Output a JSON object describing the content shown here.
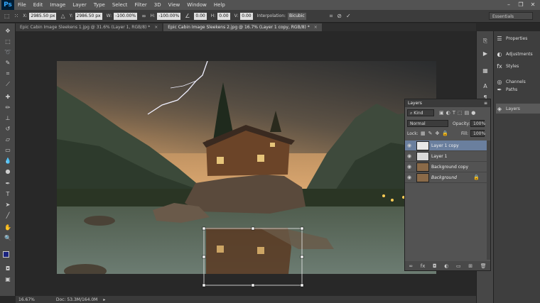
{
  "app": {
    "logo": "Ps"
  },
  "menu": [
    "File",
    "Edit",
    "Image",
    "Layer",
    "Type",
    "Select",
    "Filter",
    "3D",
    "View",
    "Window",
    "Help"
  ],
  "window_controls": [
    "–",
    "❐",
    "✕"
  ],
  "options": {
    "x_label": "X:",
    "x_value": "2985.50 px",
    "y_label": "Y:",
    "y_value": "2986.50 px",
    "w_label": "W:",
    "w_value": "-100.00%",
    "h_label": "H:",
    "h_value": "-100.00%",
    "angle_value": "0.00",
    "hskew_label": "H:",
    "hskew_value": "0.00",
    "vskew_label": "V:",
    "vskew_value": "0.00",
    "interpolation_label": "Interpolation:",
    "interpolation_value": "Bicubic",
    "workspace": "Essentials"
  },
  "tabs": [
    {
      "label": "Epic Cabin Image Sleekens 1.jpg @ 31.6% (Layer 1, RGB/8) *",
      "close": "×"
    },
    {
      "label": "Epic Cabin Image Sleekens 2.jpg @ 16.7% (Layer 1 copy, RGB/8) *",
      "close": "×"
    }
  ],
  "status": {
    "zoom": "16.67%",
    "doc": "Doc: 53.3M/164.0M"
  },
  "dock": [
    {
      "label": "Properties",
      "icon": "properties-icon"
    },
    {
      "label": "Adjustments",
      "icon": "adjustments-icon"
    },
    {
      "label": "Styles",
      "icon": "styles-icon"
    },
    {
      "label": "Channels",
      "icon": "channels-icon"
    },
    {
      "label": "Paths",
      "icon": "paths-icon"
    },
    {
      "label": "Layers",
      "icon": "layers-icon"
    }
  ],
  "layers_panel": {
    "title": "Layers",
    "filter": "Kind",
    "blend_mode": "Normal",
    "opacity_label": "Opacity:",
    "opacity_value": "100%",
    "lock_label": "Lock:",
    "fill_label": "Fill:",
    "fill_value": "100%",
    "layers": [
      {
        "name": "Layer 1 copy",
        "selected": true
      },
      {
        "name": "Layer 1",
        "selected": false
      },
      {
        "name": "Background copy",
        "selected": false
      },
      {
        "name": "Background",
        "selected": false,
        "locked": true
      }
    ]
  },
  "colors": {
    "foreground": "#1a237e",
    "background": "#ffffff"
  }
}
